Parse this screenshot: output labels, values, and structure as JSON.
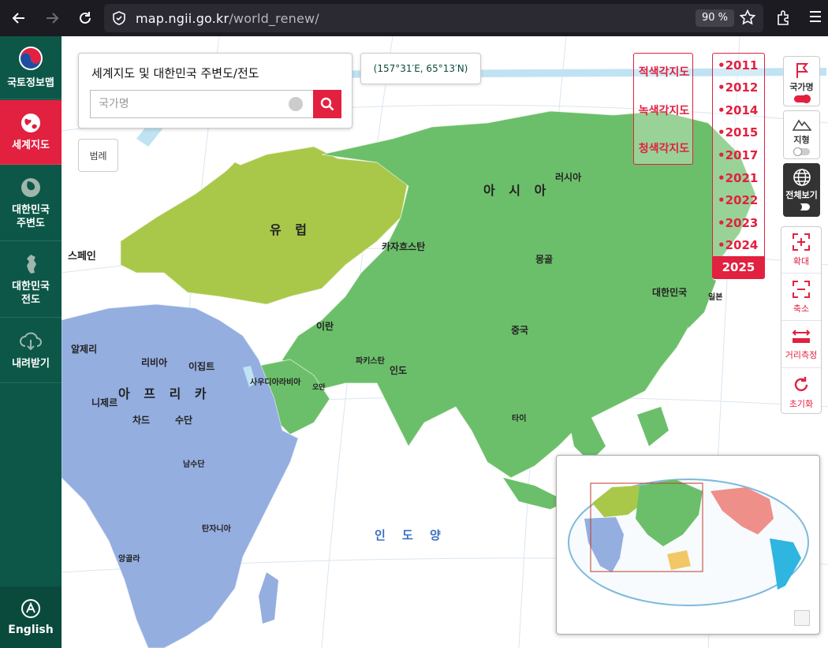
{
  "browser": {
    "url_host": "map.ngii.go.kr",
    "url_path": "/world_renew/",
    "zoom": "90 %"
  },
  "sidebar": {
    "logo_label": "국토정보맵",
    "items": [
      {
        "label": "세계지도",
        "active": true
      },
      {
        "label": "대한민국\n주변도",
        "active": false
      },
      {
        "label": "대한민국\n전도",
        "active": false
      },
      {
        "label": "내려받기",
        "active": false
      }
    ],
    "english": "English"
  },
  "search": {
    "title": "세계지도 및 대한민국 주변도/전도",
    "placeholder": "국가명"
  },
  "coordinates": "(157°31′E, 65°13′N)",
  "legend_label": "범례",
  "map_types": [
    "적색각지도",
    "녹색각지도",
    "청색각지도"
  ],
  "years": [
    "•2011",
    "•2012",
    "•2014",
    "•2015",
    "•2017",
    "•2021",
    "•2022",
    "•2023",
    "•2024",
    "2025"
  ],
  "selected_year": "2025",
  "tools": {
    "country_name": "국가명",
    "terrain": "지형",
    "full_view": "전체보기",
    "zoom_in": "확대",
    "zoom_out": "축소",
    "measure": "거리측정",
    "reset": "초기화"
  },
  "map_labels": {
    "asia": "아 시 아",
    "europe": "유 럽",
    "africa": "아 프 리 카",
    "indian_ocean": "인 도 양",
    "russia": "러시아",
    "kazakhstan": "카자흐스탄",
    "mongolia": "몽골",
    "china": "중국",
    "korea": "대한민국",
    "japan": "일본",
    "iran": "이란",
    "pakistan": "파키스탄",
    "india": "인도",
    "saudi": "사우디아라비아",
    "algeria": "알제리",
    "libya": "리비아",
    "egypt": "이집트",
    "niger": "니제르",
    "chad": "차드",
    "sudan": "수단",
    "south_sudan": "남수단",
    "angola": "앙골라",
    "tanzania": "탄자니아",
    "thailand": "타이",
    "oman": "오만",
    "spain": "스페인"
  },
  "colors": {
    "sidebar": "#0c5747",
    "accent": "#e2203f",
    "asia": "#6cbf6a",
    "europe": "#a9c84a",
    "africa": "#94aee0",
    "north_america": "#ef8f8a",
    "south_america": "#2eb5e0",
    "australia": "#f2c766"
  }
}
